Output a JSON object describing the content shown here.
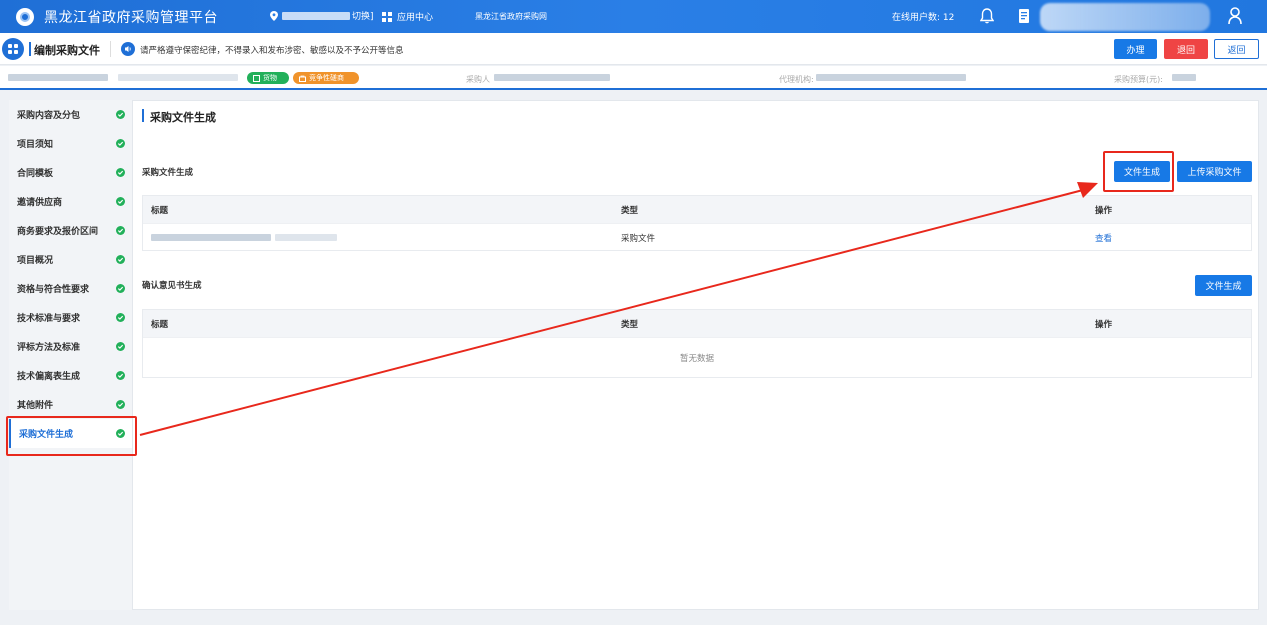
{
  "topbar": {
    "title": "黑龙江省政府采购管理平台",
    "switch_label": "切换]",
    "app_center": "应用中心",
    "procurement_net": "黑龙江省政府采购网",
    "online_users": "在线用户数: 12"
  },
  "header": {
    "page_title": "编制采购文件",
    "notice": "请严格遵守保密纪律，不得录入和发布涉密、敏感以及不予公开等信息",
    "buttons": {
      "handle": "办理",
      "return": "退回",
      "back": "返回"
    }
  },
  "info": {
    "tag_goods": "货物",
    "tag_competitive": "竞争性磋商",
    "purchaser_label": "采购人",
    "agency_label": "代理机构:",
    "budget_label": "采购预算(元):"
  },
  "sidebar": {
    "items": [
      {
        "label": "采购内容及分包"
      },
      {
        "label": "项目须知"
      },
      {
        "label": "合同模板"
      },
      {
        "label": "邀请供应商"
      },
      {
        "label": "商务要求及报价区间"
      },
      {
        "label": "项目概况"
      },
      {
        "label": "资格与符合性要求"
      },
      {
        "label": "技术标准与要求"
      },
      {
        "label": "评标方法及标准"
      },
      {
        "label": "技术偏离表生成"
      },
      {
        "label": "其他附件"
      },
      {
        "label": "采购文件生成"
      }
    ],
    "active_index": 11
  },
  "main": {
    "title": "采购文件生成",
    "section1": {
      "title": "采购文件生成",
      "generate_button": "文件生成",
      "upload_button": "上传采购文件",
      "columns": [
        "标题",
        "类型",
        "操作"
      ],
      "rows": [
        {
          "type": "采购文件",
          "action": "查看"
        }
      ]
    },
    "section2": {
      "title": "确认意见书生成",
      "generate_button": "文件生成",
      "columns": [
        "标题",
        "类型",
        "操作"
      ],
      "empty_text": "暂无数据"
    }
  },
  "colors": {
    "primary": "#1f6fd6",
    "success": "#22b05a",
    "danger": "#ef4444",
    "warning": "#f0932b",
    "annotation": "#e8281c"
  }
}
